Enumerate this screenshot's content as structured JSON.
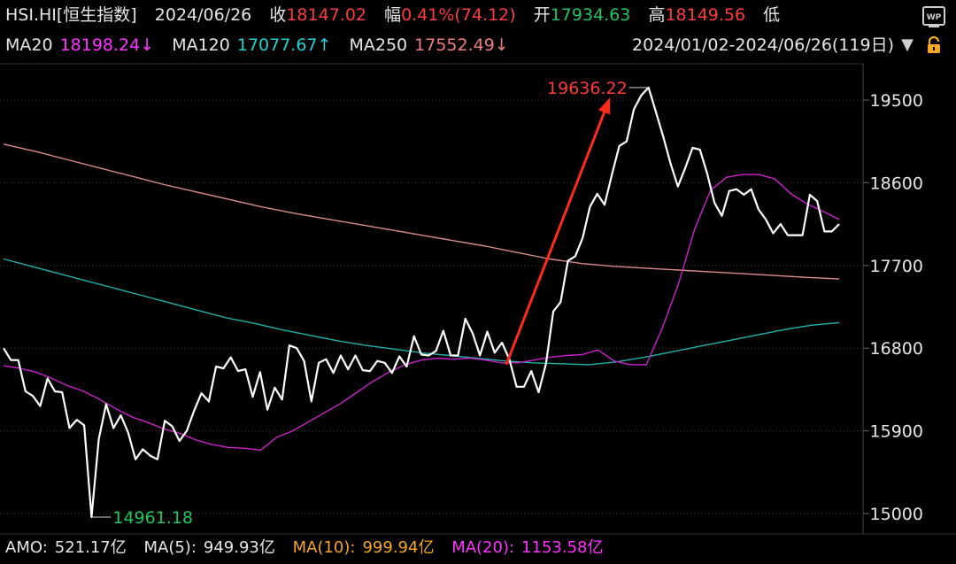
{
  "header": {
    "symbol": "HSI.HI[恒生指数]",
    "date": "2024/06/26",
    "close_label": "收",
    "close_value": "18147.02",
    "change_label": "幅",
    "change_value": "0.41%(74.12)",
    "open_label": "开",
    "open_value": "17934.63",
    "high_label": "高",
    "high_value": "18149.56",
    "low_label": "低"
  },
  "ma_row": {
    "ma20_label": "MA20",
    "ma20_value": "18198.24↓",
    "ma120_label": "MA120",
    "ma120_value": "17077.67↑",
    "ma250_label": "MA250",
    "ma250_value": "17552.49↓",
    "range_text": "2024/01/02-2024/06/26(119日)",
    "range_arrow": "▼"
  },
  "footer": {
    "amo_label": "AMO:",
    "amo_value": "521.17亿",
    "ma5_label": "MA(5):",
    "ma5_value": "949.93亿",
    "ma10_label": "MA(10):",
    "ma10_value": "999.94亿",
    "ma20_label": "MA(20):",
    "ma20_value": "1153.58亿"
  },
  "icons": {
    "top_right": "wp-icon",
    "lock": "lock-icon"
  },
  "colors": {
    "background": "#000000",
    "price_line": "#ffffff",
    "ma20": "#cc22cc",
    "ma120": "#20b2aa",
    "ma250": "#d98c8c",
    "up_red": "#ff3b3b",
    "down_green": "#22c55e",
    "arrow": "#ff2a1a",
    "grid": "#3a3a3a"
  },
  "chart_data": {
    "type": "line",
    "title": "",
    "xlabel": "",
    "ylabel": "",
    "x_range": [
      "2024/01/02",
      "2024/06/26"
    ],
    "ylim": [
      14850,
      19800
    ],
    "y_ticks": [
      15000,
      15900,
      16800,
      17700,
      18600,
      19500
    ],
    "y_tick_labels": [
      "15000",
      "15900",
      "16800",
      "17700",
      "18600",
      "19500"
    ],
    "grid": true,
    "annotations": {
      "high_label": "19636.22",
      "high_value": 19636.22,
      "low_label": "14961.18",
      "low_value": 14961.18
    },
    "series": [
      {
        "name": "HSI",
        "values": [
          16800,
          16670,
          16670,
          16330,
          16280,
          16170,
          16470,
          16330,
          16320,
          15930,
          16020,
          15960,
          14961.18,
          15810,
          16190,
          15930,
          16070,
          15880,
          15590,
          15700,
          15630,
          15590,
          16010,
          15950,
          15790,
          15900,
          16120,
          16310,
          16220,
          16600,
          16580,
          16700,
          16550,
          16570,
          16270,
          16540,
          16130,
          16370,
          16240,
          16830,
          16800,
          16660,
          16220,
          16640,
          16680,
          16530,
          16720,
          16570,
          16720,
          16560,
          16550,
          16660,
          16640,
          16530,
          16710,
          16600,
          16930,
          16730,
          16720,
          16770,
          16990,
          16720,
          16720,
          17120,
          16960,
          16720,
          16980,
          16750,
          16860,
          16680,
          16380,
          16380,
          16550,
          16320,
          16630,
          17200,
          17300,
          17750,
          17800,
          18000,
          18340,
          18480,
          18360,
          18690,
          19000,
          19050,
          19400,
          19550,
          19636.22,
          19370,
          19100,
          18810,
          18560,
          18760,
          18980,
          18960,
          18700,
          18380,
          18240,
          18510,
          18530,
          18470,
          18530,
          18310,
          18200,
          18050,
          18150,
          18030,
          18030,
          18030,
          18470,
          18400,
          18070,
          18070,
          18150
        ]
      },
      {
        "name": "MA20",
        "values": [
          16610,
          16580,
          16540,
          16470,
          16390,
          16330,
          16240,
          16140,
          16050,
          15990,
          15920,
          15870,
          15800,
          15750,
          15720,
          15710,
          15690,
          15830,
          15900,
          16000,
          16100,
          16200,
          16320,
          16440,
          16540,
          16620,
          16670,
          16690,
          16680,
          16690,
          16670,
          16640,
          16640,
          16670,
          16700,
          16720,
          16730,
          16780,
          16660,
          16620,
          16620,
          17020,
          17500,
          18090,
          18520,
          18660,
          18690,
          18690,
          18640,
          18480,
          18370,
          18290,
          18200
        ]
      },
      {
        "name": "MA120",
        "values": [
          17770,
          17690,
          17610,
          17530,
          17450,
          17370,
          17290,
          17210,
          17130,
          17070,
          17000,
          16940,
          16880,
          16830,
          16790,
          16750,
          16720,
          16690,
          16660,
          16640,
          16630,
          16620,
          16650,
          16700,
          16760,
          16820,
          16880,
          16940,
          17000,
          17050,
          17077.67
        ]
      },
      {
        "name": "MA250",
        "values": [
          19020,
          18940,
          18850,
          18760,
          18670,
          18580,
          18500,
          18420,
          18340,
          18270,
          18210,
          18150,
          18090,
          18030,
          17970,
          17910,
          17840,
          17770,
          17720,
          17690,
          17670,
          17650,
          17630,
          17610,
          17590,
          17570,
          17552.49
        ]
      }
    ]
  }
}
